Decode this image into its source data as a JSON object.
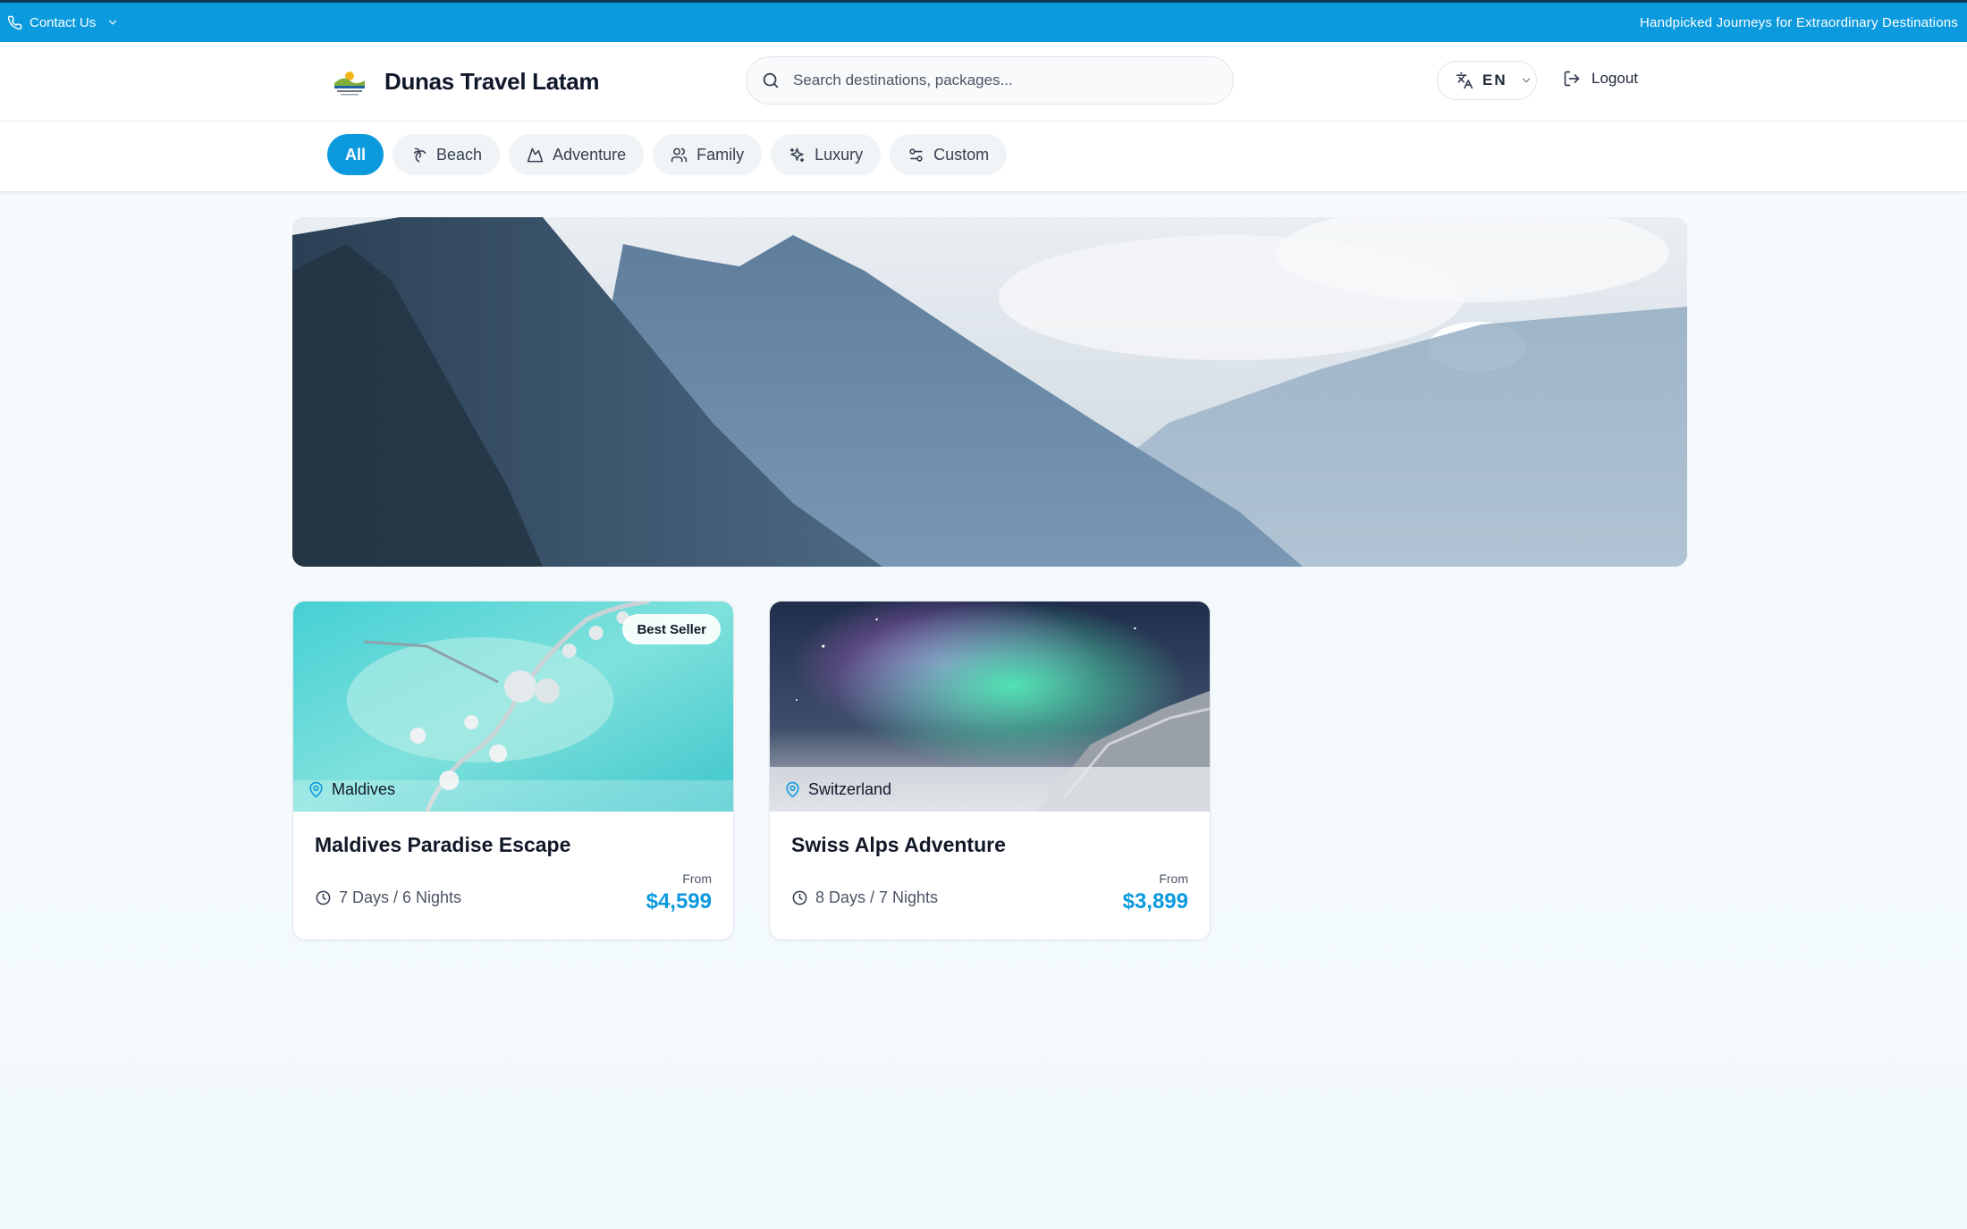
{
  "topbar": {
    "contact_label": "Contact Us",
    "tagline": "Handpicked Journeys for Extraordinary Destinations"
  },
  "header": {
    "brand_name": "Dunas Travel Latam",
    "search_placeholder": "Search destinations, packages...",
    "language": "EN",
    "logout_label": "Logout"
  },
  "categories": [
    {
      "label": "All",
      "icon": "grid",
      "active": true
    },
    {
      "label": "Beach",
      "icon": "palm-tree-icon"
    },
    {
      "label": "Adventure",
      "icon": "mountain-icon"
    },
    {
      "label": "Family",
      "icon": "users-icon"
    },
    {
      "label": "Luxury",
      "icon": "sparkles-icon"
    },
    {
      "label": "Custom",
      "icon": "sliders-icon"
    }
  ],
  "packages": [
    {
      "badge": "Best Seller",
      "location": "Maldives",
      "title": "Maldives Paradise Escape",
      "duration": "7 Days / 6 Nights",
      "from_label": "From",
      "price": "$4,599"
    },
    {
      "badge": "",
      "location": "Switzerland",
      "title": "Swiss Alps Adventure",
      "duration": "8 Days / 7 Nights",
      "from_label": "From",
      "price": "$3,899"
    }
  ],
  "colors": {
    "accent": "#0c9ade",
    "topbar_border": "#0f3b57"
  }
}
